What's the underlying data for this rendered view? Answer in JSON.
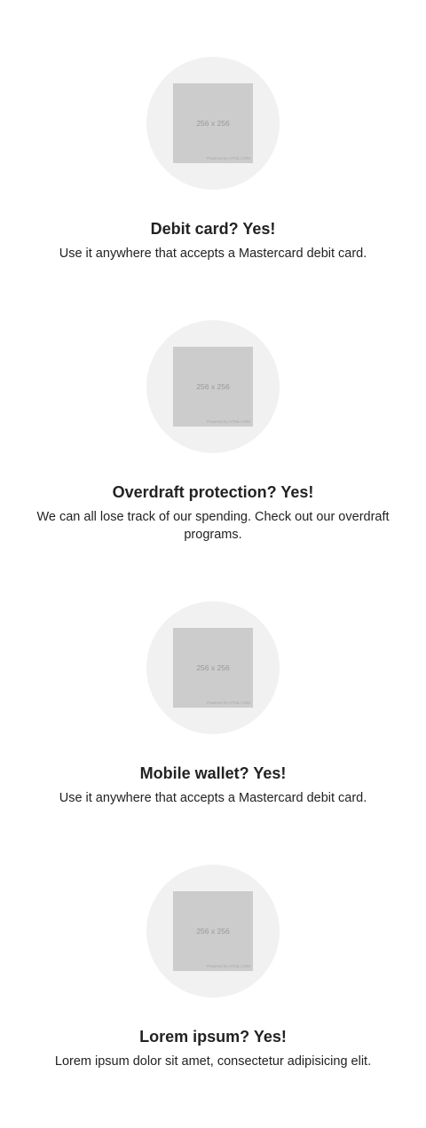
{
  "features": [
    {
      "image_size": "256 x 256",
      "image_credit": "Powered by HTML.COM",
      "title": "Debit card? Yes!",
      "text": "Use it anywhere that accepts a Mastercard debit card."
    },
    {
      "image_size": "256 x 256",
      "image_credit": "Powered by HTML.COM",
      "title": "Overdraft protection? Yes!",
      "text": "We can all lose track of our spending. Check out our overdraft programs."
    },
    {
      "image_size": "256 x 256",
      "image_credit": "Powered by HTML.COM",
      "title": "Mobile wallet? Yes!",
      "text": "Use it anywhere that accepts a Mastercard debit card."
    },
    {
      "image_size": "256 x 256",
      "image_credit": "Powered by HTML.COM",
      "title": "Lorem ipsum? Yes!",
      "text": "Lorem ipsum dolor sit amet, consectetur adipisicing elit."
    }
  ]
}
